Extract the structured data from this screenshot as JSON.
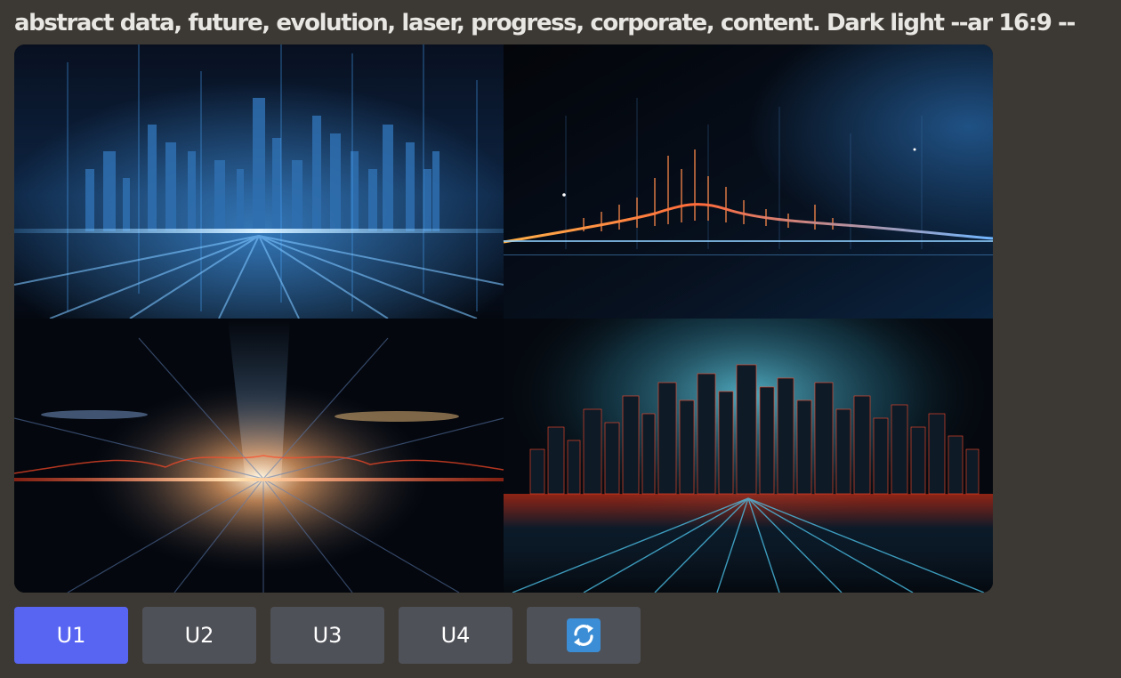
{
  "prompt": {
    "text": "abstract data, future, evolution, laser, progress, corporate, content. Dark light --ar 16:9 --"
  },
  "image_grid": {
    "images": [
      {
        "position": "top-left",
        "description_icon": "blue-city-skyline-image"
      },
      {
        "position": "top-right",
        "description_icon": "orange-data-wave-image"
      },
      {
        "position": "bottom-left",
        "description_icon": "red-laser-burst-image"
      },
      {
        "position": "bottom-right",
        "description_icon": "red-cyan-city-image"
      }
    ]
  },
  "actions": {
    "buttons": [
      {
        "label": "U1",
        "active": true
      },
      {
        "label": "U2",
        "active": false
      },
      {
        "label": "U3",
        "active": false
      },
      {
        "label": "U4",
        "active": false
      }
    ],
    "reroll_icon": "reroll-icon"
  },
  "colors": {
    "background": "#3c3833",
    "primary_button": "#5865f2",
    "secondary_button": "#4f5158",
    "reroll_icon_bg": "#3b8ed6"
  }
}
